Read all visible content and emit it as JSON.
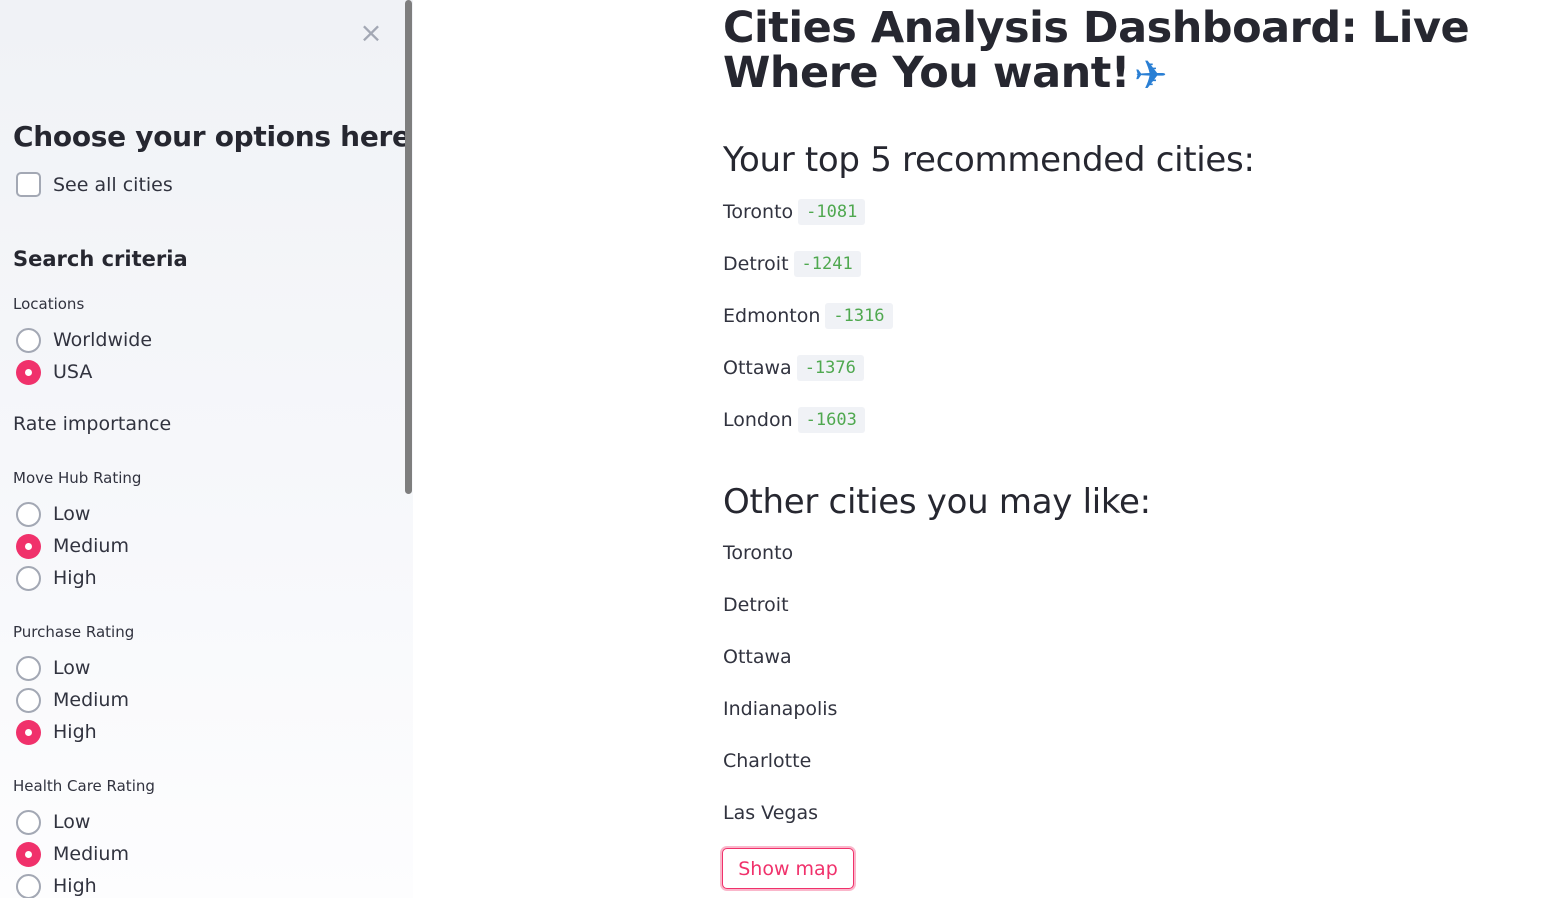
{
  "sidebar": {
    "close_symbol": "×",
    "heading": "Choose your options here",
    "see_all_label": "See all cities",
    "search_criteria": "Search criteria",
    "locations": {
      "label": "Locations",
      "options": [
        "Worldwide",
        "USA"
      ],
      "selected": "USA"
    },
    "rate_importance": "Rate importance",
    "move_hub": {
      "label": "Move Hub Rating",
      "options": [
        "Low",
        "Medium",
        "High"
      ],
      "selected": "Medium"
    },
    "purchase": {
      "label": "Purchase Rating",
      "options": [
        "Low",
        "Medium",
        "High"
      ],
      "selected": "High"
    },
    "health_care": {
      "label": "Health Care Rating",
      "options": [
        "Low",
        "Medium",
        "High"
      ],
      "selected": "Medium"
    }
  },
  "main": {
    "title": "Cities Analysis Dashboard: Live Where You want!",
    "title_icon": "airplane-icon",
    "top5_heading": "Your top 5 recommended cities:",
    "top5": [
      {
        "city": "Toronto",
        "score": "-1081"
      },
      {
        "city": "Detroit",
        "score": "-1241"
      },
      {
        "city": "Edmonton",
        "score": "-1316"
      },
      {
        "city": "Ottawa",
        "score": "-1376"
      },
      {
        "city": "London",
        "score": "-1603"
      }
    ],
    "other_heading": "Other cities you may like:",
    "other": [
      "Toronto",
      "Detroit",
      "Ottawa",
      "Indianapolis",
      "Charlotte",
      "Las Vegas"
    ],
    "show_map_label": "Show map"
  },
  "colors": {
    "accent": "#f0316b",
    "score_text": "#4fa84f",
    "sidebar_bg": "#f0f2f6"
  }
}
